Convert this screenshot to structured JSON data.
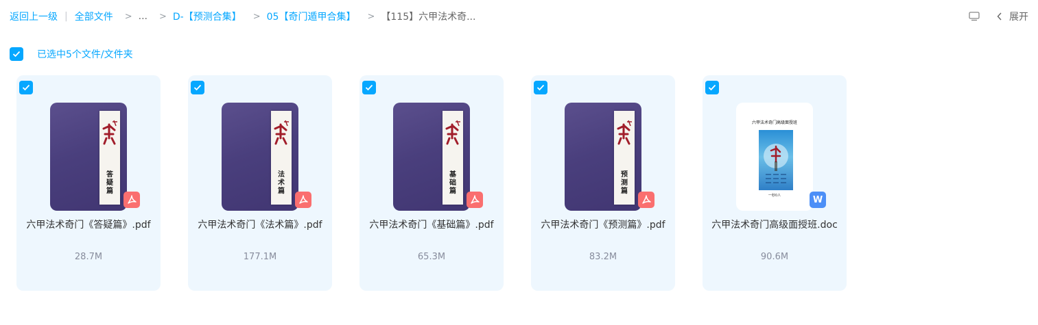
{
  "breadcrumb": {
    "back": "返回上一级",
    "all_files": "全部文件",
    "ellipsis": "...",
    "items": [
      "D-【预测合集】",
      "05【奇门遁甲合集】"
    ],
    "current": "【115】六甲法术奇...",
    "separator": ">",
    "divider": "|"
  },
  "toolbar": {
    "expand_label": "展开",
    "view_icon": "monitor-icon",
    "back_icon": "chevron-left-icon"
  },
  "selection": {
    "label": "已选中5个文件/文件夹",
    "checked": true
  },
  "colors": {
    "accent": "#06a7ff",
    "card_bg": "#eef7fe",
    "pdf_badge": "#fa6f6f",
    "doc_badge": "#4c8ff7"
  },
  "files": [
    {
      "name": "六甲法术奇门《答疑篇》.pdf",
      "size": "28.7M",
      "type": "pdf",
      "cover_subtitle": "答疑篇",
      "checked": true
    },
    {
      "name": "六甲法术奇门《法术篇》.pdf",
      "size": "177.1M",
      "type": "pdf",
      "cover_subtitle": "法术篇",
      "checked": true
    },
    {
      "name": "六甲法术奇门《基础篇》.pdf",
      "size": "65.3M",
      "type": "pdf",
      "cover_subtitle": "基础篇",
      "checked": true
    },
    {
      "name": "六甲法术奇门《预测篇》.pdf",
      "size": "83.2M",
      "type": "pdf",
      "cover_subtitle": "预测篇",
      "checked": true
    },
    {
      "name": "六甲法术奇门高级面授班.doc",
      "size": "90.6M",
      "type": "doc",
      "cover_heading": "六甲法术奇门高级面授班",
      "cover_footer": "一秒0人",
      "badge_letter": "W",
      "checked": true
    }
  ]
}
